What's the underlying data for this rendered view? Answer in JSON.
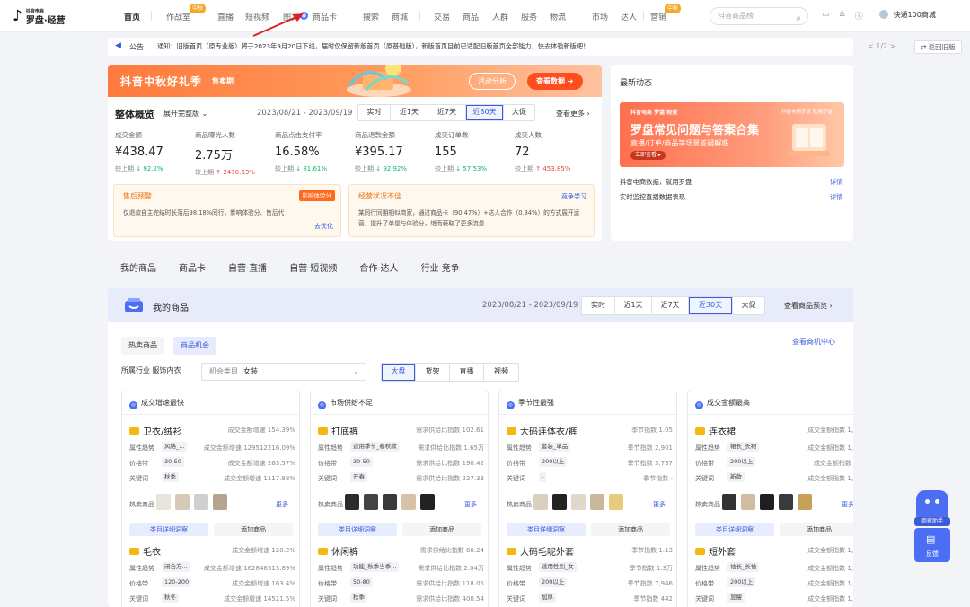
{
  "logo": {
    "icon": "douyin-logo",
    "subtitle": "抖音电商",
    "title": "罗盘·经营"
  },
  "nav": [
    {
      "label": "首页",
      "active": true
    },
    {
      "label": "作战室",
      "badge": "中秋"
    },
    {
      "label": "直播"
    },
    {
      "label": "短视频"
    },
    {
      "label": "图文"
    },
    {
      "label": "商品卡"
    },
    {
      "label": "搜索"
    },
    {
      "label": "商城"
    },
    {
      "label": "交易"
    },
    {
      "label": "商品"
    },
    {
      "label": "人群"
    },
    {
      "label": "服务"
    },
    {
      "label": "物流"
    },
    {
      "label": "市场"
    },
    {
      "label": "达人"
    },
    {
      "label": "营销",
      "badge": "中秋"
    }
  ],
  "search": {
    "placeholder": "抖音商品榜"
  },
  "user": {
    "name": "快通100商城"
  },
  "notice": {
    "label": "公告",
    "text": "通知：旧版首页（原专业版）将于2023年9月20日下线，届时仅保留新版首页（原基础版），新版首页目前已适配旧版首页全部能力，快去体验新版吧！",
    "page": "< 1/2 >",
    "back": "⇄ 返回旧版"
  },
  "overview": {
    "banner_title": "抖音中秋好礼季",
    "banner_sub": "售卖期",
    "btn_activity": "活动分析",
    "btn_data": "查看数据 ➔",
    "title": "整体概览",
    "expand": "展开完整版 ⌄",
    "date": "2023/08/21 - 2023/09/19",
    "ranges": [
      "实时",
      "近1天",
      "近7天",
      "近30天",
      "大促"
    ],
    "active_range": "近30天",
    "more": "查看更多 ›",
    "metrics": [
      {
        "label": "成交金额",
        "value": "¥438.47",
        "prefix": "较上期",
        "change": "↓ 92.2%",
        "dir": "down"
      },
      {
        "label": "商品曝光人数",
        "value": "2.75万",
        "prefix": "较上期",
        "change": "↑ 2470.63%",
        "dir": "up"
      },
      {
        "label": "商品点击支付率",
        "value": "16.58%",
        "prefix": "较上期",
        "change": "↓ 81.61%",
        "dir": "down"
      },
      {
        "label": "商品退款金额",
        "value": "¥395.17",
        "prefix": "较上期",
        "change": "↓ 92.92%",
        "dir": "down"
      },
      {
        "label": "成交订单数",
        "value": "155",
        "prefix": "较上期",
        "change": "↓ 57.53%",
        "dir": "down"
      },
      {
        "label": "成交人数",
        "value": "72",
        "prefix": "较上期",
        "change": "↑ 453.85%",
        "dir": "up"
      }
    ],
    "alert1": {
      "title": "售后预警",
      "badge": "影响体验分",
      "desc": "仅退款自主完结时长落后98.18%同行，影响体验分、售后代",
      "link": "去优化"
    },
    "alert2": {
      "title": "经营状况不佳",
      "link": "竞争学习",
      "desc": "某同行同期相似商家，通过商品卡（90.47%）+达人合作（0.34%）的方式展开运营，提升了单量与体验分，继而获取了更多流量"
    }
  },
  "news": {
    "title": "最新动态",
    "banner_top": "抖音电商 罗盘·经营",
    "banner_top_right": "抖音电商罗盘 就用罗盘",
    "banner_title": "罗盘常见问题与答案合集",
    "banner_sub": "直播/订单/商品等场景答疑解惑",
    "banner_btn": "立即查看 ▸",
    "rows": [
      {
        "text": "抖音电商数据，就用罗盘",
        "link": "详情"
      },
      {
        "text": "实时监控直播数据表现",
        "link": "详情"
      }
    ]
  },
  "tabs": [
    "我的商品",
    "商品卡",
    "自营·直播",
    "自营·短视频",
    "合作·达人",
    "行业·竞争"
  ],
  "products": {
    "title": "我的商品",
    "date": "2023/08/21 - 2023/09/19",
    "ranges": [
      "实时",
      "近1天",
      "近7天",
      "近30天",
      "大促"
    ],
    "active_range": "近30天",
    "preview": "查看商品预览 ›",
    "subtab_off": "热卖商品",
    "subtab_on": "商品机会",
    "center_link": "查看商机中心",
    "industry_label": "所属行业  服饰内衣",
    "select_label": "机会类目",
    "select_value": "女装",
    "channels": [
      "大盘",
      "货架",
      "直播",
      "视频"
    ],
    "active_channel": "大盘",
    "row_labels": {
      "attr": "属性趋势",
      "price": "价格带",
      "kw": "关键词",
      "hot": "热卖商品",
      "more": "更多",
      "detail": "类目详细洞察",
      "add": "添加商品"
    },
    "cards": [
      {
        "title": "成交增速最快",
        "items": [
          {
            "name": "卫衣/绒衫",
            "metric": "成交金额增速 154.39%",
            "rows": [
              {
                "tag": "风格_...",
                "val": "成交金额增速 129512216.09%"
              },
              {
                "tag": "30-50",
                "val": "成交金额增速 263.57%"
              },
              {
                "tag": "秋季",
                "val": "成交金额增速 1117.88%"
              }
            ]
          },
          {
            "name": "毛衣",
            "metric": "成交金额增速 120.2%",
            "rows": [
              {
                "tag": "闭合方...",
                "val": "成交金额增速 162846513.89%"
              },
              {
                "tag": "120-200",
                "val": "成交金额增速 163.4%"
              },
              {
                "tag": "秋冬",
                "val": "成交金额增速 14521.5%"
              }
            ]
          }
        ]
      },
      {
        "title": "市场供给不足",
        "items": [
          {
            "name": "打底裤",
            "metric": "需求供给比指数 102.61",
            "rows": [
              {
                "tag": "适用季节_春秋款",
                "val": "需求供给比指数 1.65万"
              },
              {
                "tag": "30-50",
                "val": "需求供给比指数 190.42"
              },
              {
                "tag": "开春",
                "val": "需求供给比指数 227.33"
              }
            ]
          },
          {
            "name": "休闲裤",
            "metric": "需求供给比指数 60.24",
            "rows": [
              {
                "tag": "功能_秋季当季...",
                "val": "需求供给比指数 2.04万"
              },
              {
                "tag": "50-80",
                "val": "需求供给比指数 118.05"
              },
              {
                "tag": "秋季",
                "val": "需求供给比指数 400.54"
              }
            ]
          }
        ]
      },
      {
        "title": "季节性最强",
        "items": [
          {
            "name": "大码连体衣/裤",
            "metric": "季节指数 1.05",
            "rows": [
              {
                "tag": "套装_单品",
                "val": "季节指数 2,901"
              },
              {
                "tag": "200以上",
                "val": "季节指数 3,737"
              },
              {
                "tag": "-",
                "val": "季节指数 -"
              }
            ]
          },
          {
            "name": "大码毛呢外套",
            "metric": "季节指数 1.13",
            "rows": [
              {
                "tag": "适用性别_女",
                "val": "季节指数 1.3万"
              },
              {
                "tag": "200以上",
                "val": "季节指数 7,946"
              },
              {
                "tag": "加厚",
                "val": "季节指数 442"
              }
            ]
          }
        ]
      },
      {
        "title": "成交金额最高",
        "items": [
          {
            "name": "连衣裙",
            "metric": "成交金额指数 1,33",
            "rows": [
              {
                "tag": "裙长_长裙",
                "val": "成交金额指数 1,20"
              },
              {
                "tag": "200以上",
                "val": "成交金额指数 71"
              },
              {
                "tag": "新款",
                "val": "成交金额指数 1,20"
              }
            ]
          },
          {
            "name": "短外套",
            "metric": "成交金额指数 1,10",
            "rows": [
              {
                "tag": "袖长_长袖",
                "val": "成交金额指数 1,20"
              },
              {
                "tag": "200以上",
                "val": "成交金额指数 1,10"
              },
              {
                "tag": "显瘦",
                "val": "成交金额指数 1,10"
              }
            ]
          }
        ]
      }
    ]
  },
  "assistant": {
    "label": "商家助手",
    "feedback": "反馈"
  },
  "colors": {
    "accent": "#3b5bdb",
    "banner": "#ff7a3d",
    "up": "#e8453c",
    "down": "#17b26a",
    "badge": "#f5a623"
  }
}
